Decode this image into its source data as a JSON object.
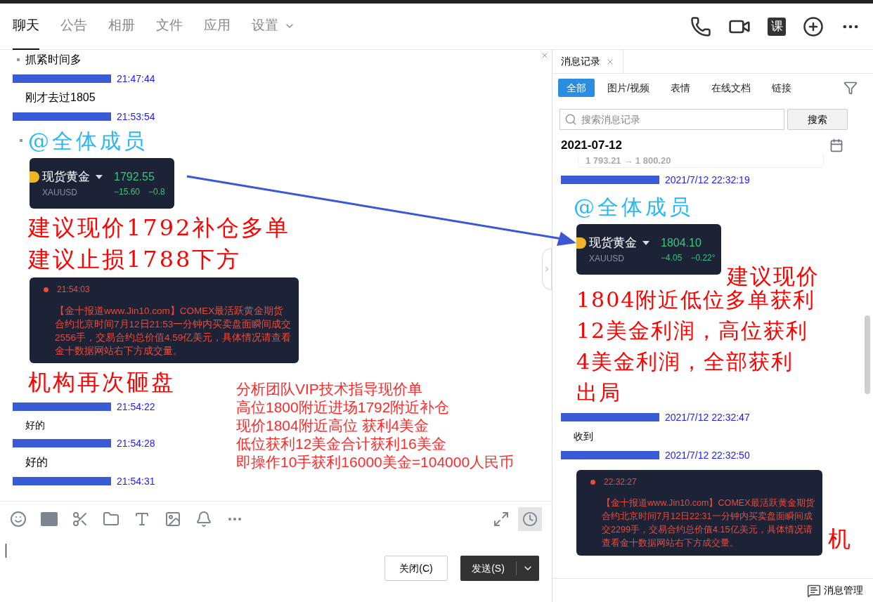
{
  "tabs": [
    {
      "label": "聊天",
      "selected": true
    },
    {
      "label": "公告",
      "selected": false
    },
    {
      "label": "相册",
      "selected": false
    },
    {
      "label": "文件",
      "selected": false
    },
    {
      "label": "应用",
      "selected": false
    },
    {
      "label": "设置",
      "selected": false,
      "dropdown": true
    }
  ],
  "header_actions": {
    "class_badge": "课"
  },
  "chat": {
    "messages": [
      {
        "kind": "text",
        "text": "抓紧时间多",
        "bullet": true
      },
      {
        "kind": "header",
        "time": "21:47:44"
      },
      {
        "kind": "text",
        "text": "刚才去过1805",
        "bullet": false
      },
      {
        "kind": "header",
        "time": "21:53:54"
      },
      {
        "kind": "mention",
        "text": "@全体成员"
      },
      {
        "kind": "quote",
        "name": "现货黄金",
        "symbol": "XAUUSD",
        "price": "1792.55",
        "change": "−15.60",
        "percent": "−0.8"
      },
      {
        "kind": "annotation",
        "text": "建议现价1792补仓多单"
      },
      {
        "kind": "annotation",
        "text": "建议止损1788下方"
      },
      {
        "kind": "news",
        "time": "21:54:03",
        "text": "【金十报道www.Jin10.com】COMEX最活跃黄金期货合约北京时间7月12日21:53一分钟内买卖盘面瞬间成交2556手，交易合约总价值4.59亿美元，具体情况请查看金十数据网站右下方成交量。"
      },
      {
        "kind": "annotation",
        "text": "机构再次砸盘"
      },
      {
        "kind": "header",
        "time": "21:54:22"
      },
      {
        "kind": "note",
        "text": "好的"
      },
      {
        "kind": "header",
        "time": "21:54:28"
      },
      {
        "kind": "text",
        "text": "好的",
        "bullet": false
      },
      {
        "kind": "header",
        "time": "21:54:31"
      }
    ],
    "summary_note": [
      "分析团队VIP技术指导现价单",
      "高位1800附近进场1792附近补仓",
      "现价1804附近高位 获利4美金",
      "低位获利12美金合计获利16美金",
      "即操作10手获利16000美金=104000人民币"
    ],
    "buttons": {
      "close": "关闭(C)",
      "send": "发送(S)"
    }
  },
  "history": {
    "title": "消息记录",
    "filters": [
      {
        "label": "全部",
        "selected": true
      },
      {
        "label": "图片/视频",
        "selected": false
      },
      {
        "label": "表情",
        "selected": false
      },
      {
        "label": "在线文档",
        "selected": false
      },
      {
        "label": "链接",
        "selected": false
      }
    ],
    "search": {
      "placeholder": "搜索消息记录",
      "button": "搜索"
    },
    "date": "2021-07-12",
    "cut_card": "1 793.21 → 1 800.20",
    "messages": [
      {
        "kind": "header",
        "time": "2021/7/12 22:32:19"
      },
      {
        "kind": "mention",
        "text": "@全体成员"
      },
      {
        "kind": "quote",
        "name": "现货黄金",
        "symbol": "XAUUSD",
        "price": "1804.10",
        "change": "−4.05",
        "percent": "−0.22°",
        "annotation": [
          "建议现价",
          "1804附近低位多单获利",
          "12美金利润，高位获利",
          "4美金利润，全部获利",
          "出局"
        ]
      },
      {
        "kind": "header",
        "time": "2021/7/12 22:32:47"
      },
      {
        "kind": "note",
        "text": "收到"
      },
      {
        "kind": "header",
        "time": "2021/7/12 22:32:50"
      },
      {
        "kind": "news",
        "time": "22:32:27",
        "text": "【金十报道www.Jin10.com】COMEX最活跃黄金期货合约北京时间7月12日22:31一分钟内买卖盘面瞬间成交2299手，交易合约总价值4.15亿美元，具体情况请查看金十数据网站右下方成交量。",
        "annotation": "机"
      }
    ],
    "manage": "消息管理"
  }
}
